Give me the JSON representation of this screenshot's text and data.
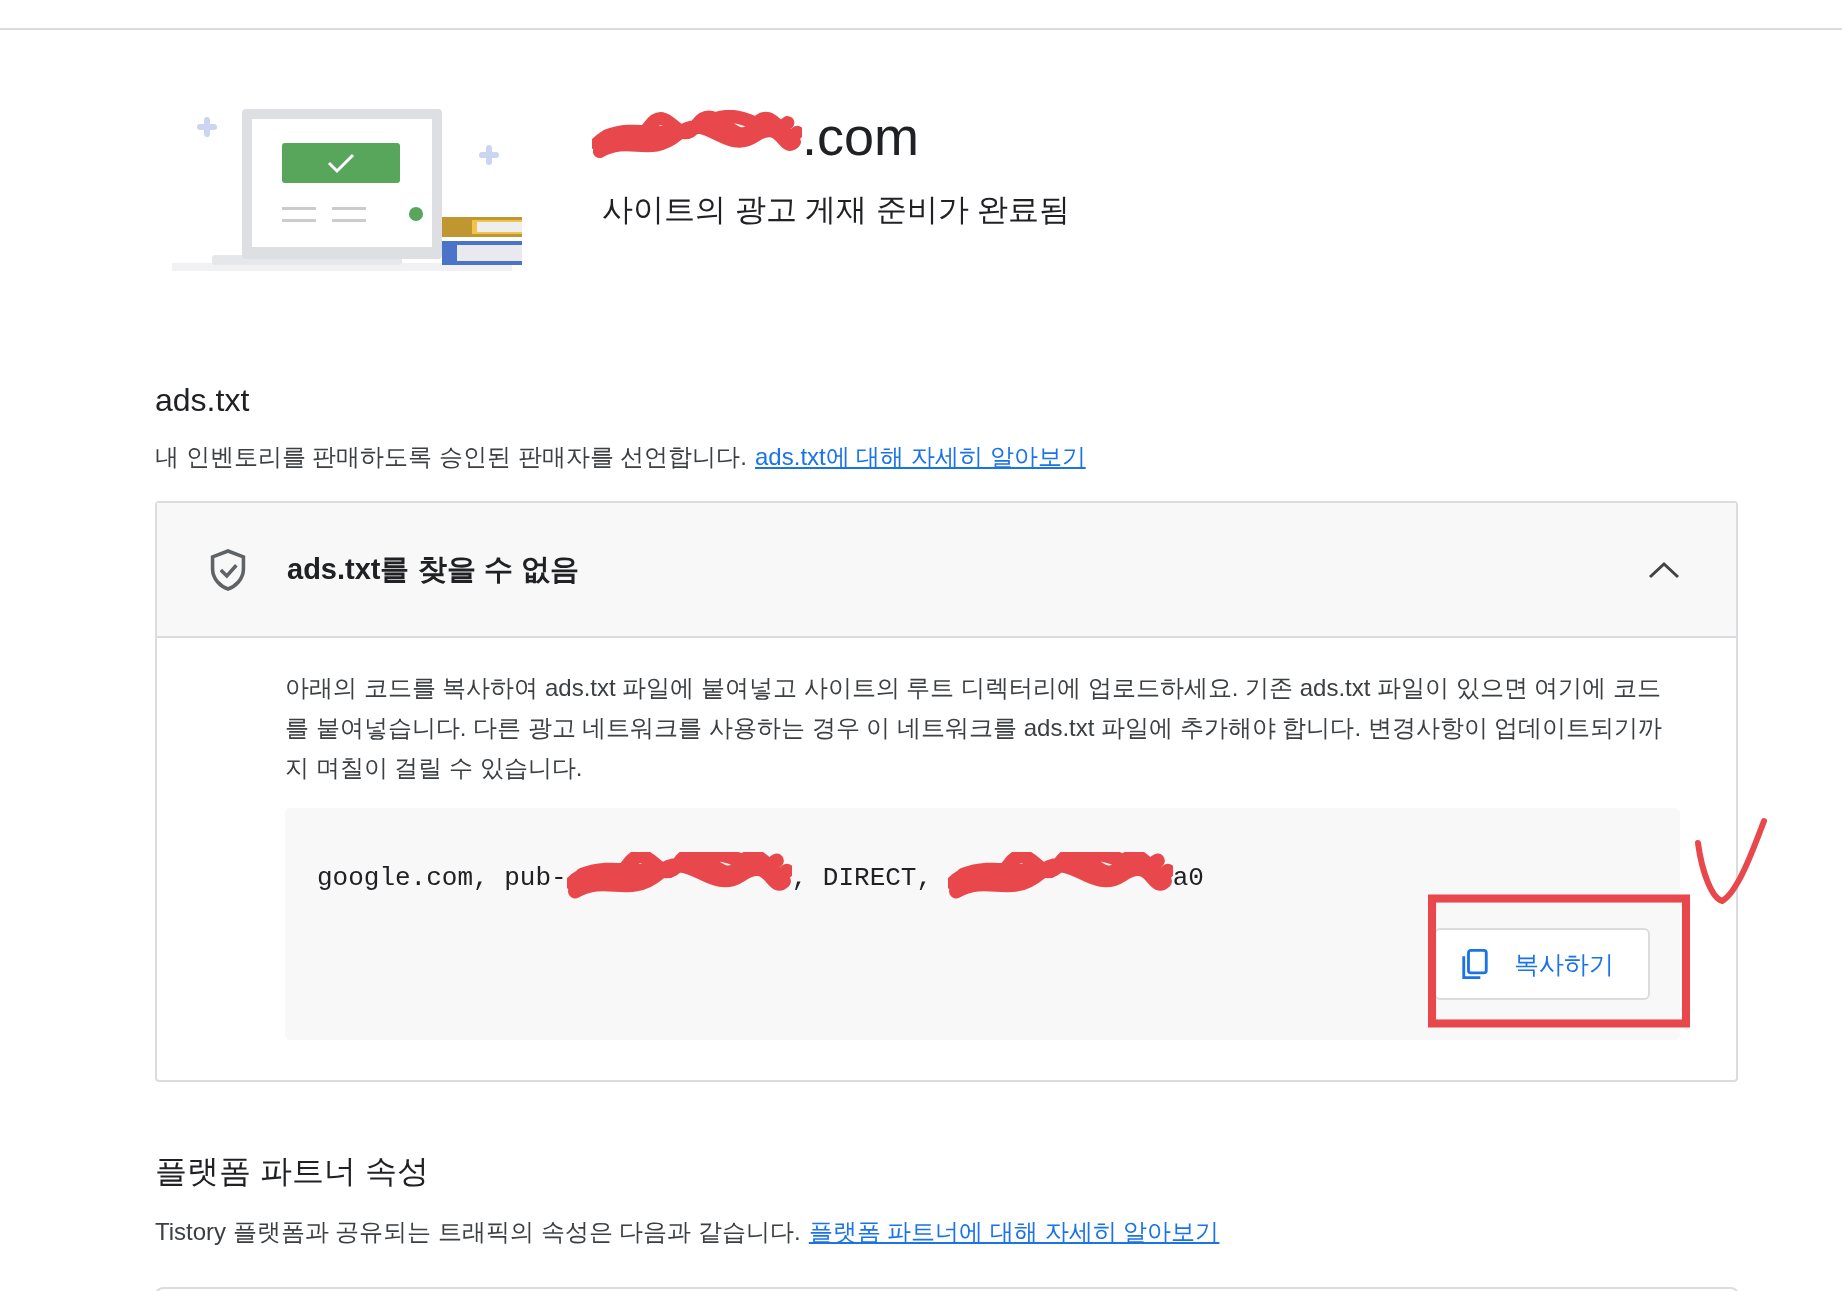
{
  "site": {
    "domain": ".com",
    "status": "사이트의 광고 게재 준비가 완료됨"
  },
  "ads_txt": {
    "title": "ads.txt",
    "description": "내 인벤토리를 판매하도록 승인된 판매자를 선언합니다.",
    "link": "ads.txt에 대해 자세히 알아보기",
    "panel": {
      "title": "ads.txt를 찾을 수 없음",
      "expanded": true,
      "instructions": "아래의 코드를 복사하여 ads.txt 파일에 붙여넣고 사이트의 루트 디렉터리에 업로드하세요. 기존 ads.txt 파일이 있으면 여기에 코드를 붙여넣습니다. 다른 광고 네트워크를 사용하는 경우 이 네트워크를 ads.txt 파일에 추가해야 합니다. 변경사항이 업데이트되기까지 며칠이 걸릴 수 있습니다.",
      "code_parts": [
        "google.com, pub-",
        ", DIRECT, ",
        "a0"
      ],
      "copy_button": "복사하기"
    }
  },
  "platform_partner": {
    "title": "플랫폼 파트너 속성",
    "description": "Tistory 플랫폼과 공유되는 트래픽의 속성은 다음과 같습니다.",
    "link": "플랫폼 파트너에 대해 자세히 알아보기"
  }
}
